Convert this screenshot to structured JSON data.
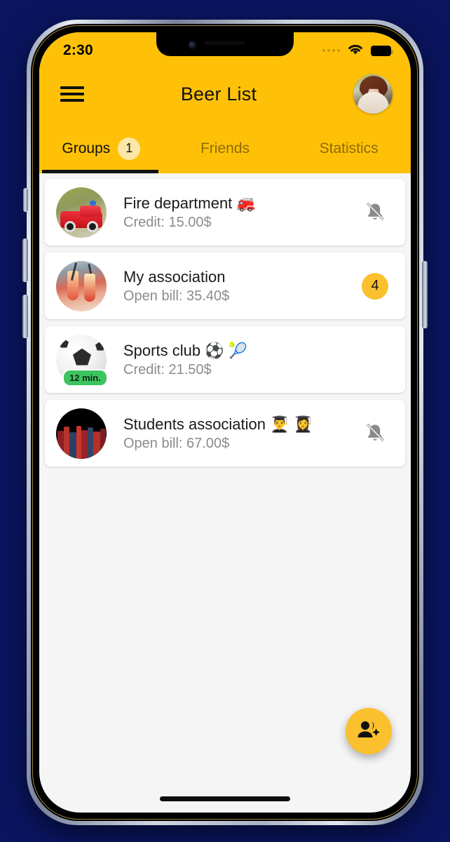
{
  "theme": {
    "background": "#0a1560",
    "accent": "#FFC107",
    "fab": "#FBC02D",
    "badge_soft": "#FBE7A8",
    "screen_bg": "#f5f5f5",
    "card_bg": "#ffffff",
    "title_color": "#1a1a1a",
    "subtitle_color": "#8b8b8b",
    "online_badge": "#3ec45f"
  },
  "status_bar": {
    "time": "2:30",
    "signal_icon": "signal-dots-icon",
    "wifi_icon": "wifi-icon",
    "battery_icon": "battery-full-icon"
  },
  "header": {
    "menu_icon": "hamburger-menu-icon",
    "title": "Beer List",
    "avatar_icon": "user-avatar"
  },
  "tabs": [
    {
      "label": "Groups",
      "badge": "1",
      "active": true
    },
    {
      "label": "Friends",
      "badge": "",
      "active": false
    },
    {
      "label": "Statistics",
      "badge": "",
      "active": false
    }
  ],
  "groups": [
    {
      "title": "Fire department 🚒",
      "subtitle": "Credit: 15.00$",
      "thumb": "fire-truck-photo",
      "time_badge": "",
      "right_kind": "bell",
      "right_icon": "bell-off-icon",
      "right_value": ""
    },
    {
      "title": "My association",
      "subtitle": "Open bill: 35.40$",
      "thumb": "drinks-cheers-photo",
      "time_badge": "",
      "right_kind": "count",
      "right_icon": "notification-count-badge",
      "right_value": "4"
    },
    {
      "title": "Sports club ⚽ 🎾",
      "subtitle": "Credit: 21.50$",
      "thumb": "soccer-ball-photo",
      "time_badge": "12 min.",
      "right_kind": "none",
      "right_icon": "",
      "right_value": ""
    },
    {
      "title": "Students association 👨‍🎓 👩‍🎓",
      "subtitle": "Open bill: 67.00$",
      "thumb": "books-learning-photo",
      "time_badge": "",
      "right_kind": "bell",
      "right_icon": "bell-off-icon",
      "right_value": ""
    }
  ],
  "fab": {
    "icon": "person-add-icon",
    "label": ""
  },
  "system": {
    "home_indicator": "home-indicator"
  }
}
